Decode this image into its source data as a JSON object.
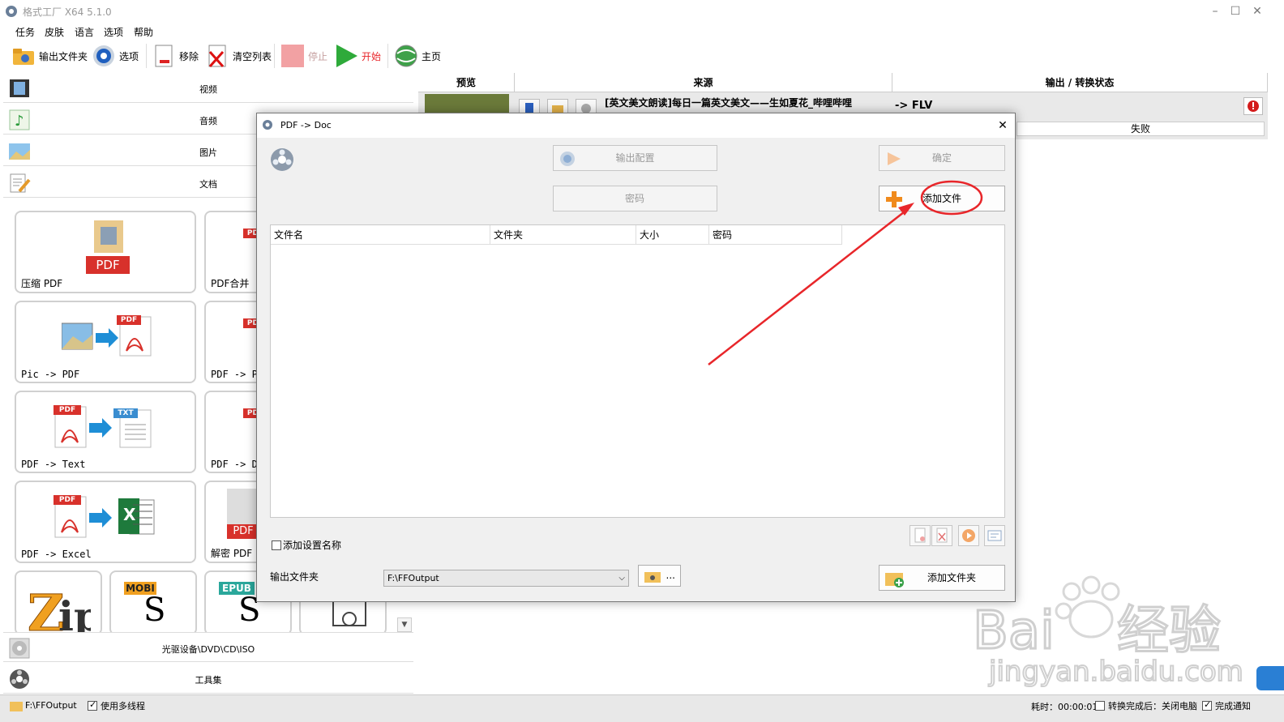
{
  "window": {
    "title": "格式工厂 X64 5.1.0"
  },
  "menu": [
    "任务",
    "皮肤",
    "语言",
    "选项",
    "帮助"
  ],
  "toolbar": {
    "output_folder": "输出文件夹",
    "options": "选项",
    "remove": "移除",
    "clear_list": "清空列表",
    "stop": "停止",
    "start": "开始",
    "home": "主页"
  },
  "categories": {
    "video": "视频",
    "audio": "音频",
    "picture": "图片",
    "document": "文档",
    "rom": "光驱设备\\DVD\\CD\\ISO",
    "tools": "工具集"
  },
  "tiles": {
    "compress_pdf": "压缩 PDF",
    "pdf_merge": "PDF合并",
    "pic_to_pdf": "Pic -> PDF",
    "pdf_to_p": "PDF -> P",
    "pdf_to_text": "PDF -> Text",
    "pdf_to_d": "PDF -> D",
    "pdf_to_excel": "PDF -> Excel",
    "decrypt_pdf": "解密 PDF",
    "badge_pdf": "PDF",
    "badge_txt": "TXT",
    "badge_mobi": "MOBI",
    "badge_epub": "EPUB",
    "badge_x": "X"
  },
  "task_list": {
    "col_preview": "预览",
    "col_source": "来源",
    "col_output": "输出 / 转换状态",
    "row_source": "[英文美文朗读]每日一篇英文美文——生如夏花_哔哩哔哩",
    "row_format": "-> FLV",
    "row_status": "失败"
  },
  "dialog": {
    "title": "PDF -> Doc",
    "output_config": "输出配置",
    "ok": "确定",
    "password": "密码",
    "add_file": "添加文件",
    "columns": [
      "文件名",
      "文件夹",
      "大小",
      "密码"
    ],
    "add_setting_name": "添加设置名称",
    "output_folder_label": "输出文件夹",
    "output_folder_value": "F:\\FFOutput",
    "browse": "...",
    "add_folder": "添加文件夹"
  },
  "status": {
    "folder": "F:\\FFOutput",
    "multithread": "使用多线程",
    "elapsed": "耗时：00:00:01",
    "after_convert": "转换完成后：关闭电脑",
    "notify": "完成通知"
  },
  "colors": {
    "accent_red": "#e8262a",
    "pdf_red": "#d8312b",
    "start_green": "#2eaa3a"
  }
}
